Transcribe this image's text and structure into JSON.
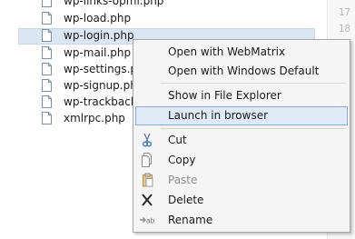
{
  "file_tree": {
    "items": [
      {
        "name": "wp-links-opml.php"
      },
      {
        "name": "wp-load.php"
      },
      {
        "name": "wp-login.php"
      },
      {
        "name": "wp-mail.php"
      },
      {
        "name": "wp-settings.php"
      },
      {
        "name": "wp-signup.php"
      },
      {
        "name": "wp-trackback.php"
      },
      {
        "name": "xmlrpc.php"
      }
    ]
  },
  "editor": {
    "line_numbers": [
      "17",
      "18"
    ]
  },
  "context_menu": {
    "open_with_webmatrix": "Open with WebMatrix",
    "open_with_windows_default": "Open with Windows Default",
    "show_in_file_explorer": "Show in File Explorer",
    "launch_in_browser": "Launch in browser",
    "cut": "Cut",
    "copy": "Copy",
    "paste": "Paste",
    "delete": "Delete",
    "rename": "Rename"
  }
}
